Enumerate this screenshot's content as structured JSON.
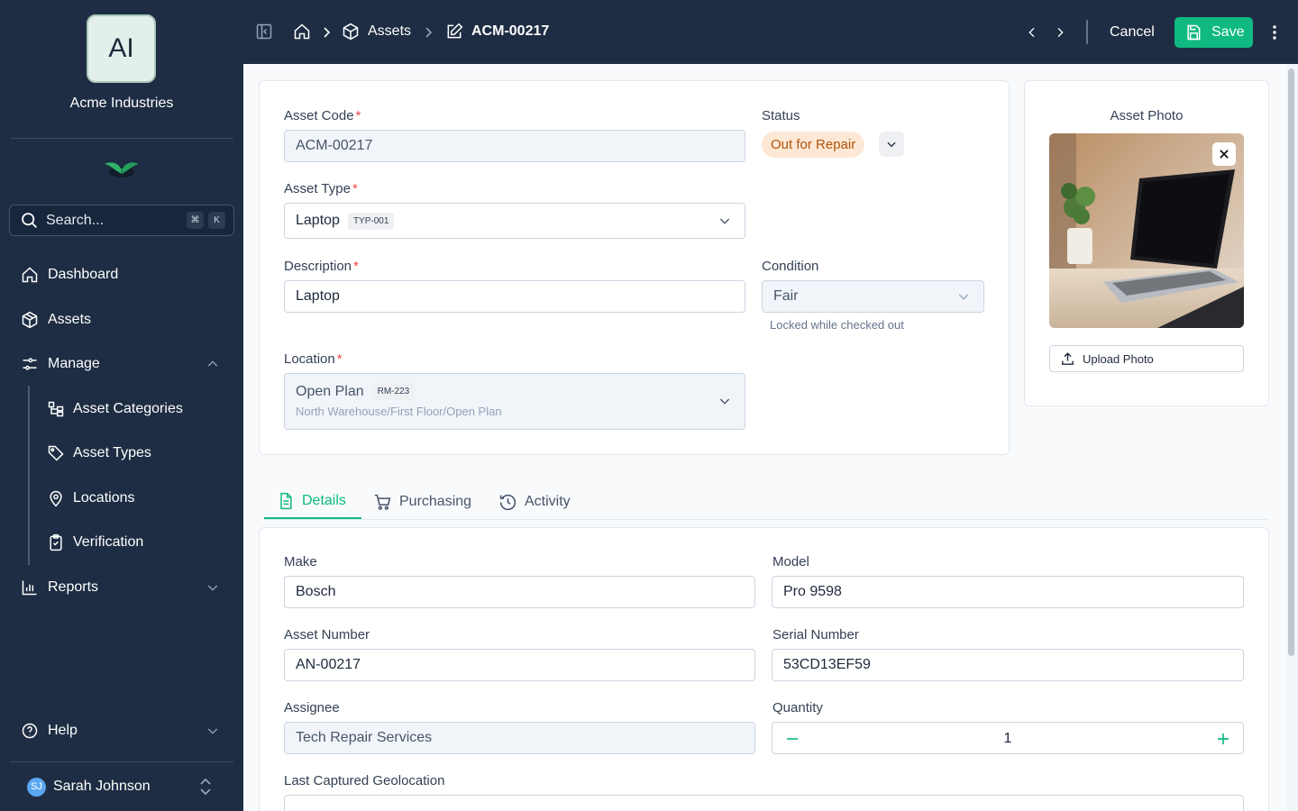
{
  "org": {
    "initials": "AI",
    "name": "Acme Industries"
  },
  "search": {
    "placeholder": "Search...",
    "kbd1": "⌘",
    "kbd2": "K"
  },
  "nav": {
    "dashboard": "Dashboard",
    "assets": "Assets",
    "manage": "Manage",
    "manage_items": [
      "Asset Categories",
      "Asset Types",
      "Locations",
      "Verification"
    ],
    "reports": "Reports",
    "help": "Help"
  },
  "user": {
    "initials": "SJ",
    "name": "Sarah Johnson"
  },
  "breadcrumb": {
    "section": "Assets",
    "current": "ACM-00217"
  },
  "toolbar": {
    "cancel": "Cancel",
    "save": "Save"
  },
  "form": {
    "asset_code_label": "Asset Code",
    "asset_code": "ACM-00217",
    "status_label": "Status",
    "status": "Out for Repair",
    "asset_type_label": "Asset Type",
    "asset_type": "Laptop",
    "asset_type_tag": "TYP-001",
    "description_label": "Description",
    "description": "Laptop",
    "condition_label": "Condition",
    "condition": "Fair",
    "condition_hint": "Locked while checked out",
    "location_label": "Location",
    "location": "Open Plan",
    "location_tag": "RM-223",
    "location_path": "North Warehouse/First Floor/Open Plan",
    "required_mark": "*"
  },
  "photo": {
    "title": "Asset Photo",
    "upload": "Upload Photo"
  },
  "tabs": [
    "Details",
    "Purchasing",
    "Activity"
  ],
  "details": {
    "make_label": "Make",
    "make": "Bosch",
    "model_label": "Model",
    "model": "Pro 9598",
    "asset_number_label": "Asset Number",
    "asset_number": "AN-00217",
    "serial_label": "Serial Number",
    "serial": "53CD13EF59",
    "assignee_label": "Assignee",
    "assignee": "Tech Repair Services",
    "quantity_label": "Quantity",
    "quantity": "1",
    "geo_label": "Last Captured Geolocation"
  },
  "colors": {
    "sidebar": "#1e2d43",
    "accent": "#10b981",
    "status_bg": "#fde8d5",
    "status_text": "#b45309"
  }
}
